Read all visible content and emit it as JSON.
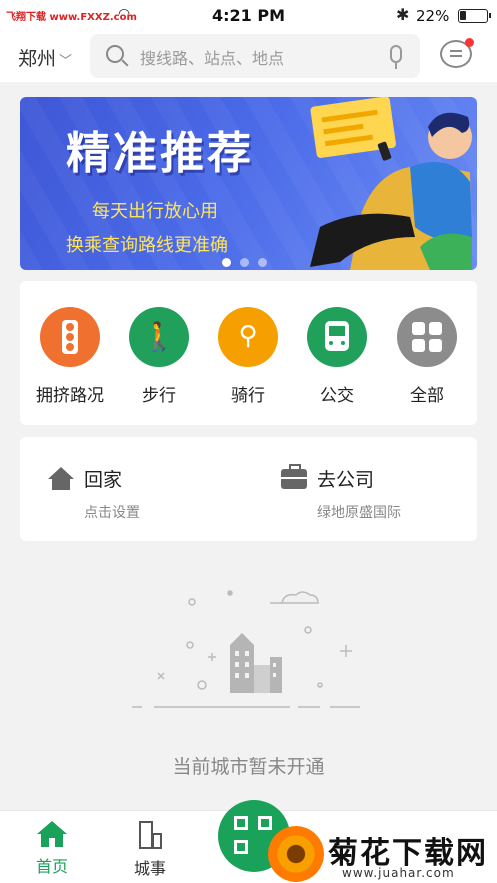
{
  "status_bar": {
    "carrier": "飞翔下载 www.FXXZ.com",
    "time": "4:21 PM",
    "battery_text": "22%",
    "battery_level": 0.22
  },
  "header": {
    "city": "郑州",
    "search_placeholder": "搜线路、站点、地点"
  },
  "banner": {
    "title": "精准推荐",
    "line1": "每天出行放心用",
    "line2": "换乘查询路线更准确",
    "dot_count": 3,
    "active_dot": 0
  },
  "quick_actions": [
    {
      "label": "拥挤路况",
      "icon": "traffic-light-icon",
      "color": "#f07030"
    },
    {
      "label": "步行",
      "icon": "walking-icon",
      "color": "#20a05a"
    },
    {
      "label": "骑行",
      "icon": "bicycle-icon",
      "color": "#f5a000"
    },
    {
      "label": "公交",
      "icon": "bus-icon",
      "color": "#20a05a"
    },
    {
      "label": "全部",
      "icon": "grid-icon",
      "color": "#8c8c8c"
    }
  ],
  "favorites": {
    "home": {
      "title": "回家",
      "subtitle": "点击设置"
    },
    "work": {
      "title": "去公司",
      "subtitle": "绿地原盛国际"
    }
  },
  "empty_state": {
    "message": "当前城市暂未开通"
  },
  "tab_bar": {
    "home_label": "首页",
    "city_label": "城事",
    "active_color": "#1aa25a"
  },
  "watermark": {
    "title": "菊花下载网",
    "url": "www.juahar.com"
  }
}
